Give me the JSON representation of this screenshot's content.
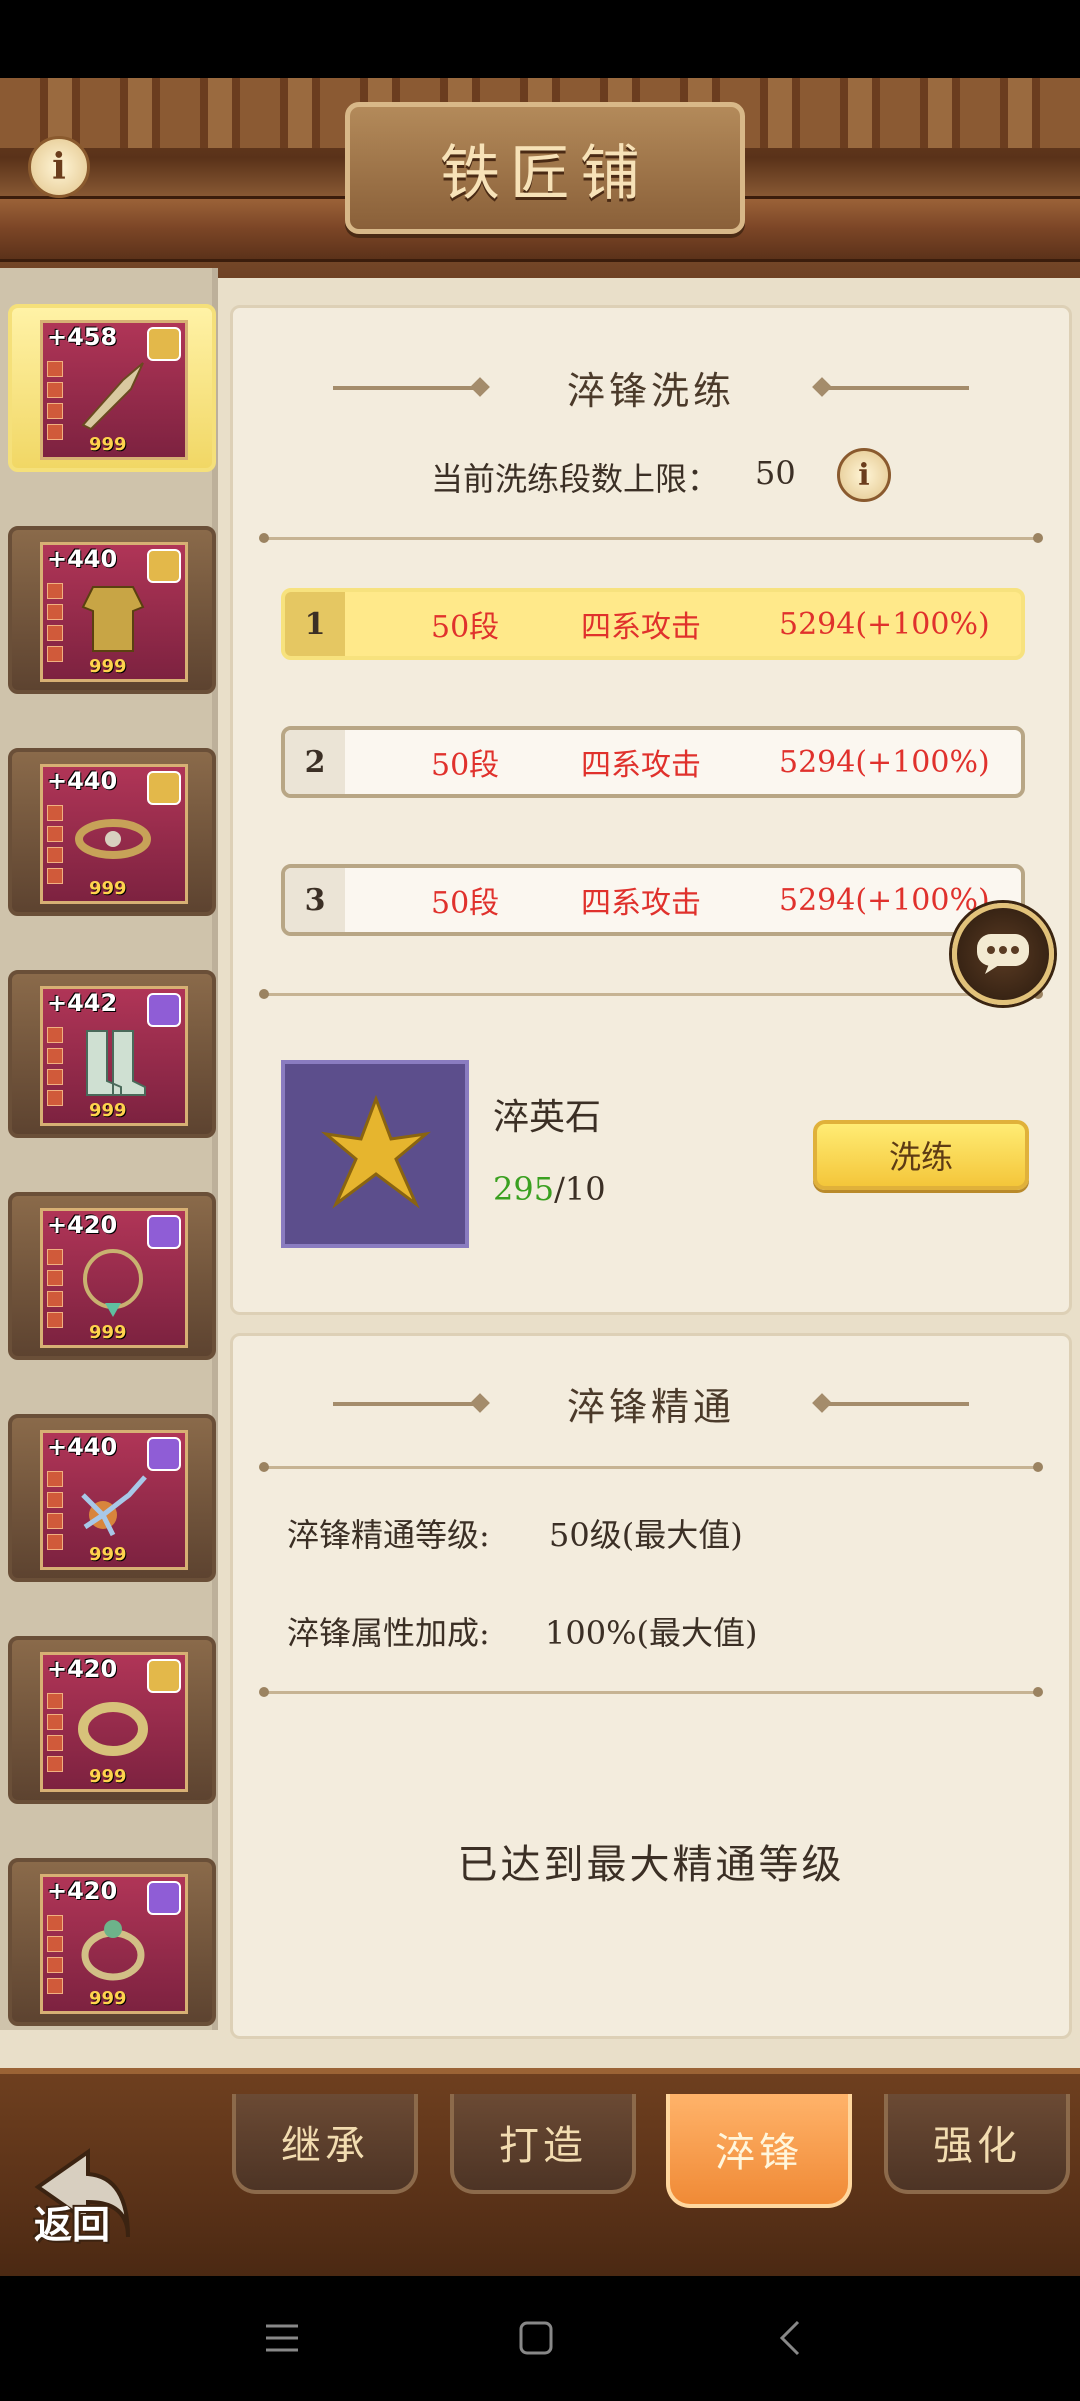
{
  "header": {
    "title": "铁匠铺"
  },
  "equipment": [
    {
      "level": "+458",
      "count": "999",
      "star": "gold",
      "selected": true
    },
    {
      "level": "+440",
      "count": "999",
      "star": "gold",
      "selected": false
    },
    {
      "level": "+440",
      "count": "999",
      "star": "gold",
      "selected": false
    },
    {
      "level": "+442",
      "count": "999",
      "star": "purple",
      "selected": false
    },
    {
      "level": "+420",
      "count": "999",
      "star": "purple",
      "selected": false
    },
    {
      "level": "+440",
      "count": "999",
      "star": "purple",
      "selected": false
    },
    {
      "level": "+420",
      "count": "999",
      "star": "gold",
      "selected": false
    },
    {
      "level": "+420",
      "count": "999",
      "star": "purple",
      "selected": false
    }
  ],
  "refine": {
    "title": "淬锋洗练",
    "limit_label": "当前洗练段数上限：",
    "limit_value": "50",
    "options": [
      {
        "num": "1",
        "stage": "50段",
        "attr": "四系攻击",
        "value": "5294(+100%)"
      },
      {
        "num": "2",
        "stage": "50段",
        "attr": "四系攻击",
        "value": "5294(+100%)"
      },
      {
        "num": "3",
        "stage": "50段",
        "attr": "四系攻击",
        "value": "5294(+100%)"
      }
    ],
    "material_name": "淬英石",
    "material_have": "295",
    "material_need": "/10",
    "wash_button": "洗练"
  },
  "mastery": {
    "title": "淬锋精通",
    "level_label": "淬锋精通等级:",
    "level_value": "50级(最大值)",
    "bonus_label": "淬锋属性加成:",
    "bonus_value": "100%(最大值)",
    "max_message": "已达到最大精通等级"
  },
  "tabs": [
    "继承",
    "打造",
    "淬锋",
    "强化"
  ],
  "active_tab": "淬锋",
  "back_label": "返回",
  "colors": {
    "accent_red": "#e0312c",
    "highlight_yellow": "#ffe98a",
    "have_green": "#3aa020"
  }
}
